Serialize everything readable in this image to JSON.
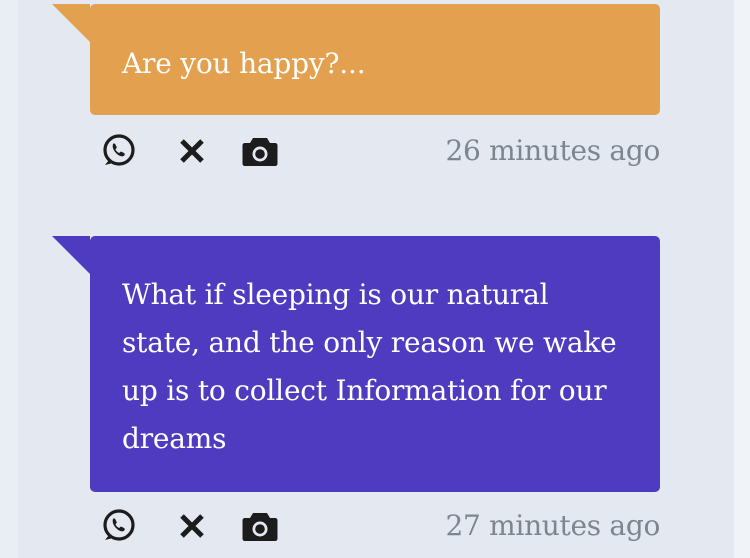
{
  "posts": [
    {
      "text": "Are you happy?...",
      "time": "26 minutes ago",
      "color": "#e3a04e"
    },
    {
      "text": "What if sleeping is our natural state, and the only reason we wake up is to collect Information for our dreams",
      "time": "27 minutes ago",
      "color": "#4f3bbf"
    }
  ],
  "icons": {
    "share": "whatsapp-icon",
    "dismiss": "close-icon",
    "snapshot": "camera-icon"
  },
  "colors": {
    "background": "#e3e8f1",
    "icon": "#1c1c1c",
    "timestamp": "#7d8590"
  }
}
